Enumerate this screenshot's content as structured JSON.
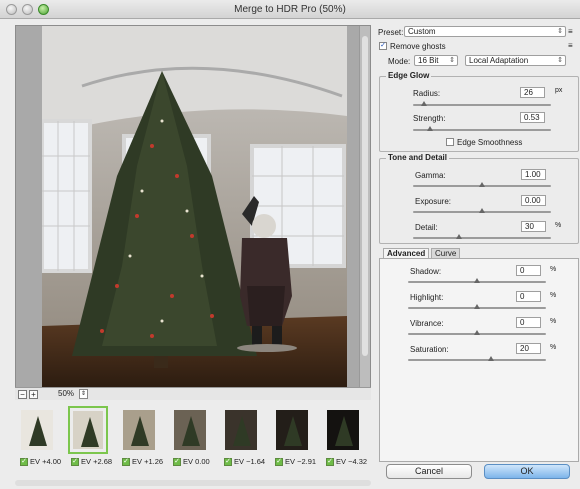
{
  "window": {
    "title": "Merge to HDR Pro (50%)"
  },
  "preview": {
    "zoom": "50%"
  },
  "filmstrip": [
    {
      "ev": "EV +4.00",
      "checked": true,
      "selected": false,
      "tone": "#e9e6df"
    },
    {
      "ev": "EV +2.68",
      "checked": true,
      "selected": true,
      "tone": "#d7d2c6"
    },
    {
      "ev": "EV +1.26",
      "checked": true,
      "selected": false,
      "tone": "#a99f8c"
    },
    {
      "ev": "EV 0.00",
      "checked": true,
      "selected": false,
      "tone": "#6b6254"
    },
    {
      "ev": "EV −1.64",
      "checked": true,
      "selected": false,
      "tone": "#3a332b"
    },
    {
      "ev": "EV −2.91",
      "checked": true,
      "selected": false,
      "tone": "#231e19"
    },
    {
      "ev": "EV −4.32",
      "checked": true,
      "selected": false,
      "tone": "#141210"
    }
  ],
  "panel": {
    "preset_label": "Preset:",
    "preset_value": "Custom",
    "remove_ghosts": "Remove ghosts",
    "mode_label": "Mode:",
    "bit_value": "16 Bit",
    "method_value": "Local Adaptation",
    "edge_glow": {
      "title": "Edge Glow",
      "radius_label": "Radius:",
      "radius_value": "26",
      "radius_unit": "px",
      "radius_pos": 0.08,
      "strength_label": "Strength:",
      "strength_value": "0.53",
      "strength_pos": 0.12,
      "smoothness_label": "Edge Smoothness"
    },
    "tone_detail": {
      "title": "Tone and Detail",
      "gamma_label": "Gamma:",
      "gamma_value": "1.00",
      "gamma_pos": 0.5,
      "exposure_label": "Exposure:",
      "exposure_value": "0.00",
      "exposure_pos": 0.5,
      "detail_label": "Detail:",
      "detail_value": "30",
      "detail_unit": "%",
      "detail_pos": 0.33
    },
    "tabs": {
      "advanced": "Advanced",
      "curve": "Curve"
    },
    "advanced": {
      "shadow_label": "Shadow:",
      "shadow_value": "0",
      "shadow_unit": "%",
      "shadow_pos": 0.5,
      "highlight_label": "Highlight:",
      "highlight_value": "0",
      "highlight_unit": "%",
      "highlight_pos": 0.5,
      "vibrance_label": "Vibrance:",
      "vibrance_value": "0",
      "vibrance_unit": "%",
      "vibrance_pos": 0.5,
      "saturation_label": "Saturation:",
      "saturation_value": "20",
      "saturation_unit": "%",
      "saturation_pos": 0.6
    },
    "cancel": "Cancel",
    "ok": "OK"
  }
}
